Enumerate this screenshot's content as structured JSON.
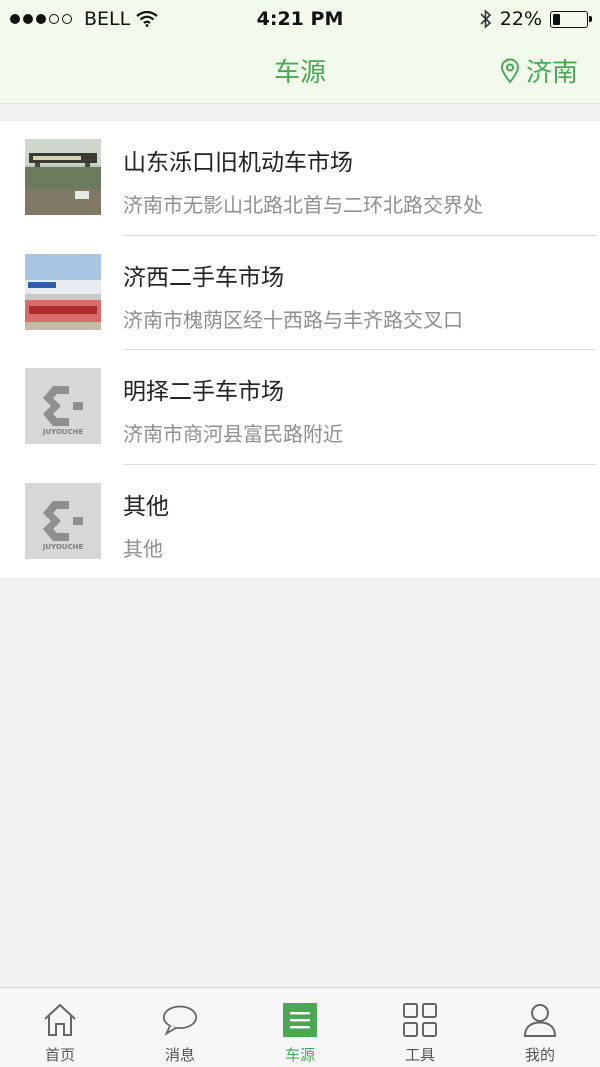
{
  "status_bar": {
    "carrier": "BELL",
    "time": "4:21 PM",
    "battery_text": "22%",
    "battery_level": 0.22,
    "signal_bars": 3
  },
  "nav": {
    "title": "车源",
    "city": "济南",
    "location_icon": "location-pin-icon"
  },
  "markets": [
    {
      "name": "山东泺口旧机动车市场",
      "address": "济南市无影山北路北首与二环北路交界处",
      "thumbnail": "market-photo"
    },
    {
      "name": "济西二手车市场",
      "address": "济南市槐荫区经十西路与丰齐路交叉口",
      "thumbnail": "market-photo"
    },
    {
      "name": "明择二手车市场",
      "address": "济南市商河县富民路附近",
      "thumbnail": "placeholder-logo"
    },
    {
      "name": "其他",
      "address": "其他",
      "thumbnail": "placeholder-logo"
    }
  ],
  "placeholder_logo_text": "JUYOUCHE",
  "tabs": [
    {
      "label": "首页",
      "icon": "home-icon",
      "active": false
    },
    {
      "label": "消息",
      "icon": "chat-bubble-icon",
      "active": false
    },
    {
      "label": "车源",
      "icon": "list-icon",
      "active": true
    },
    {
      "label": "工具",
      "icon": "grid-icon",
      "active": false
    },
    {
      "label": "我的",
      "icon": "user-icon",
      "active": false
    }
  ],
  "colors": {
    "accent": "#4aa855",
    "header_bg": "#f2fbeb",
    "page_bg": "#f0f0f0"
  }
}
